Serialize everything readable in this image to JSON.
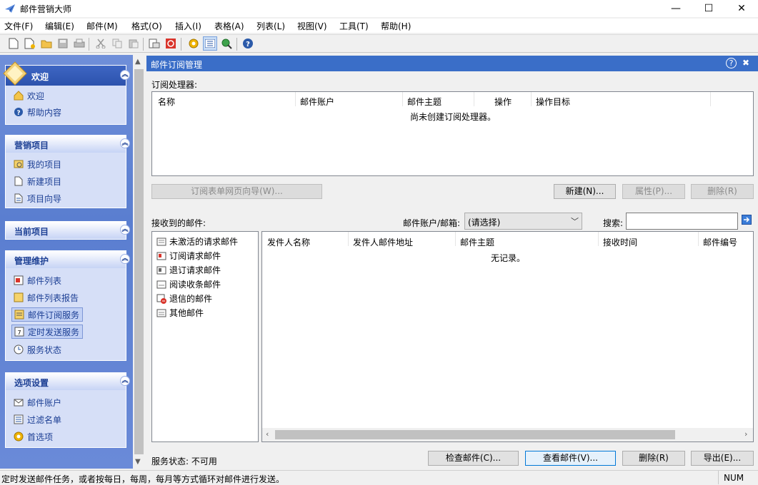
{
  "window": {
    "title": "邮件营销大师",
    "minimize": "—",
    "maximize": "☐",
    "close": "✕"
  },
  "menubar": [
    "文件(F)",
    "编辑(E)",
    "邮件(M)",
    "格式(O)",
    "插入(I)",
    "表格(A)",
    "列表(L)",
    "视图(V)",
    "工具(T)",
    "帮助(H)"
  ],
  "sidebar": {
    "welcome": {
      "title": "欢迎",
      "items": [
        "欢迎",
        "帮助内容"
      ]
    },
    "marketing": {
      "title": "营销项目",
      "items": [
        "我的项目",
        "新建项目",
        "项目向导"
      ]
    },
    "current": {
      "title": "当前项目"
    },
    "manage": {
      "title": "管理维护",
      "items": [
        "邮件列表",
        "邮件列表报告",
        "邮件订阅服务",
        "定时发送服务",
        "服务状态"
      ]
    },
    "options": {
      "title": "选项设置",
      "items": [
        "邮件账户",
        "过滤名单",
        "首选项"
      ]
    }
  },
  "panel": {
    "title": "邮件订阅管理",
    "help": "?",
    "close": "✖"
  },
  "handlers": {
    "label": "订阅处理器:",
    "columns": [
      "名称",
      "邮件账户",
      "邮件主题",
      "操作",
      "操作目标"
    ],
    "empty": "尚未创建订阅处理器。"
  },
  "buttons": {
    "wizard": "订阅表单网页向导(W)...",
    "new": "新建(N)...",
    "props": "属性(P)...",
    "delete_top": "删除(R)",
    "check": "检查邮件(C)...",
    "view": "查看邮件(V)...",
    "delete": "删除(R)",
    "export": "导出(E)..."
  },
  "received": {
    "label": "接收到的邮件:",
    "account_label": "邮件账户/邮箱:",
    "account_value": "(请选择)",
    "search_label": "搜索:",
    "search_value": ""
  },
  "folders": [
    "未激活的请求邮件",
    "订阅请求邮件",
    "退订请求邮件",
    "阅读收条邮件",
    "退信的邮件",
    "其他邮件"
  ],
  "mails": {
    "columns": [
      "发件人名称",
      "发件人邮件地址",
      "邮件主题",
      "接收时间",
      "邮件编号"
    ],
    "empty": "无记录。"
  },
  "service_status": "服务状态: 不可用",
  "statusbar": {
    "text": "定时发送邮件任务，或者按每日，每周，每月等方式循环对邮件进行发送。",
    "num": "NUM"
  }
}
